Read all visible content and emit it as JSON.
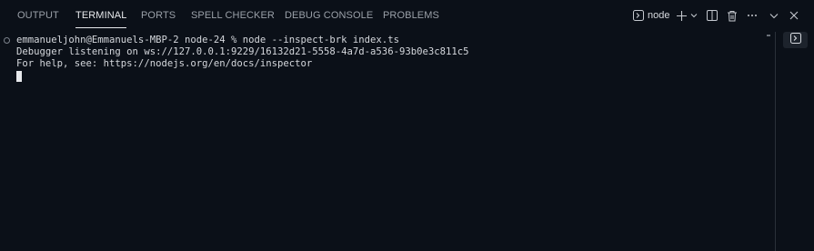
{
  "tabs": [
    {
      "label": "OUTPUT",
      "active": false
    },
    {
      "label": "TERMINAL",
      "active": true
    },
    {
      "label": "PORTS",
      "active": false
    },
    {
      "label": "SPELL CHECKER",
      "active": false
    },
    {
      "label": "DEBUG CONSOLE",
      "active": false
    },
    {
      "label": "PROBLEMS",
      "active": false
    }
  ],
  "toolbar": {
    "terminal_name": "node",
    "icons": [
      "terminal-icon",
      "plus-icon",
      "chevron-down-icon",
      "split-icon",
      "trash-icon",
      "more-icon",
      "chevron-down-icon",
      "close-icon"
    ]
  },
  "terminal": {
    "lines": [
      "emmanueljohn@Emmanuels-MBP-2 node-24 % node --inspect-brk index.ts",
      "Debugger listening on ws://127.0.0.1:9229/16132d21-5558-4a7d-a536-93b0e3c811c5",
      "For help, see: https://nodejs.org/en/docs/inspector"
    ]
  },
  "sidebar": {
    "items": [
      {
        "icon": "terminal-icon",
        "active": true
      }
    ]
  },
  "colors": {
    "background": "#0b1018",
    "text": "#d4d7dc",
    "tab_inactive": "#9aa0a8",
    "tab_active": "#e8eaed",
    "cursor": "#e6e8eb"
  }
}
